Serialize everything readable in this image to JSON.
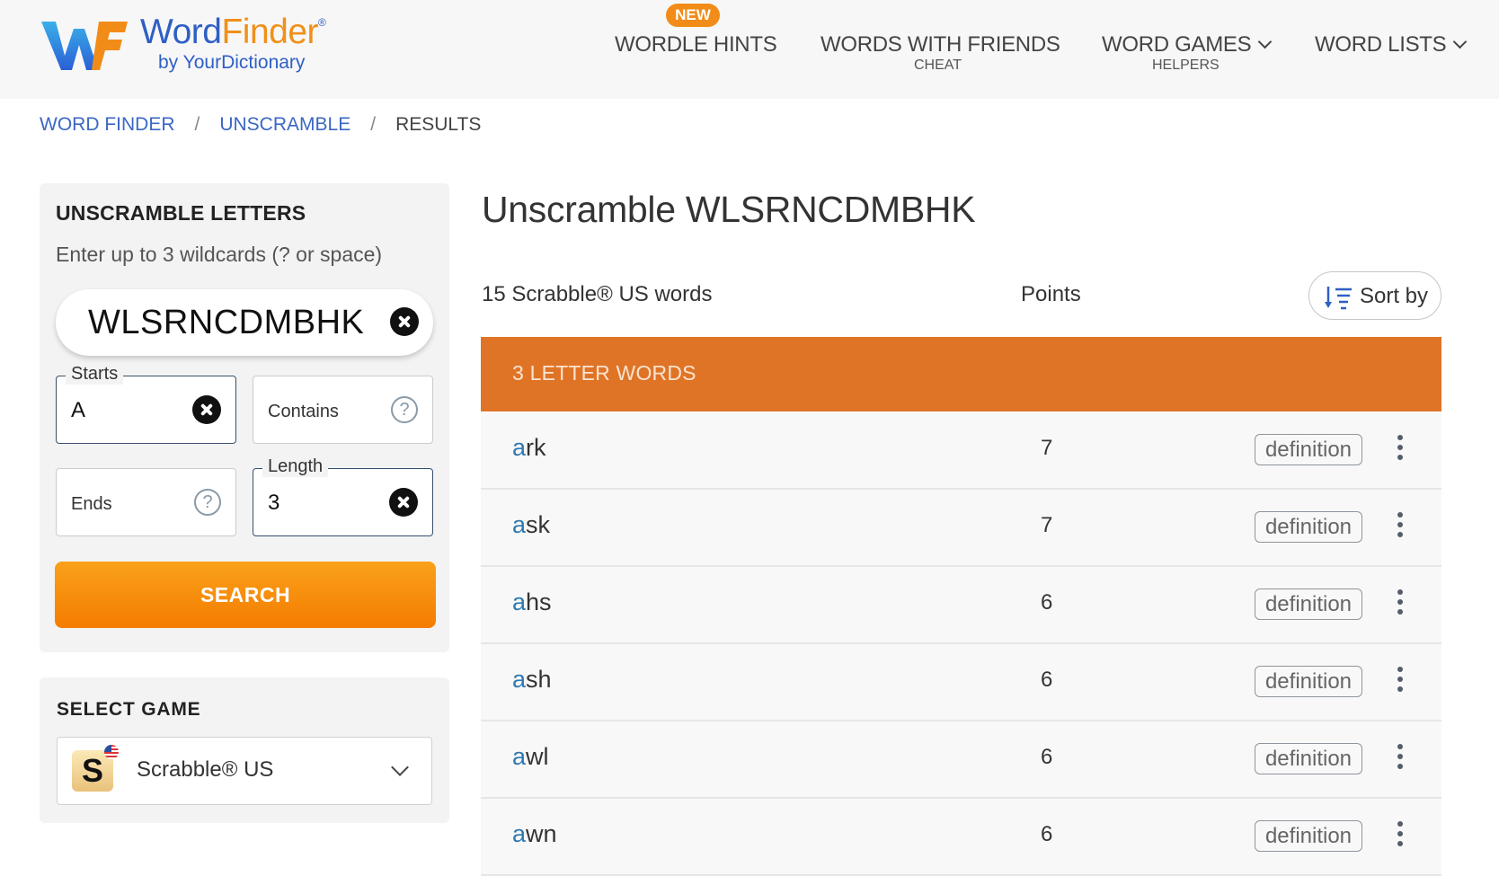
{
  "header": {
    "logo": {
      "word1": "Word",
      "word2": "Finder",
      "reg": "®",
      "sub": "by YourDictionary"
    },
    "nav": [
      {
        "label": "WORDLE HINTS",
        "badge": "NEW",
        "sub": ""
      },
      {
        "label": "WORDS WITH FRIENDS",
        "sub": "CHEAT"
      },
      {
        "label": "WORD GAMES",
        "sub": "HELPERS",
        "dropdown": true
      },
      {
        "label": "WORD LISTS",
        "sub": "",
        "dropdown": true
      }
    ]
  },
  "breadcrumb": [
    {
      "label": "WORD FINDER",
      "link": true
    },
    {
      "label": "UNSCRAMBLE",
      "link": true
    },
    {
      "label": "RESULTS",
      "link": false
    }
  ],
  "search_panel": {
    "title": "UNSCRAMBLE LETTERS",
    "hint": "Enter up to 3 wildcards (? or space)",
    "letters_value": "WLSRNCDMBHK",
    "starts": {
      "label": "Starts",
      "value": "A"
    },
    "contains": {
      "placeholder": "Contains",
      "value": ""
    },
    "ends": {
      "placeholder": "Ends",
      "value": ""
    },
    "length": {
      "label": "Length",
      "value": "3"
    },
    "search_label": "SEARCH"
  },
  "game_panel": {
    "title": "SELECT GAME",
    "selected": "Scrabble® US",
    "icon_letter": "S"
  },
  "results": {
    "title": "Unscramble WLSRNCDMBHK",
    "count_text": "15 Scrabble® US words",
    "points_header": "Points",
    "sort_label": "Sort by",
    "group_title": "3 LETTER WORDS",
    "definition_label": "definition",
    "words": [
      {
        "prefix": "a",
        "rest": "rk",
        "points": "7"
      },
      {
        "prefix": "a",
        "rest": "sk",
        "points": "7"
      },
      {
        "prefix": "a",
        "rest": "hs",
        "points": "6"
      },
      {
        "prefix": "a",
        "rest": "sh",
        "points": "6"
      },
      {
        "prefix": "a",
        "rest": "wl",
        "points": "6"
      },
      {
        "prefix": "a",
        "rest": "wn",
        "points": "6"
      }
    ]
  },
  "colors": {
    "brand_blue": "#2f5fc4",
    "brand_orange": "#f0901a",
    "group_header": "#df7427",
    "search_button": "#f57c00",
    "highlight_letter": "#2f78b0"
  }
}
